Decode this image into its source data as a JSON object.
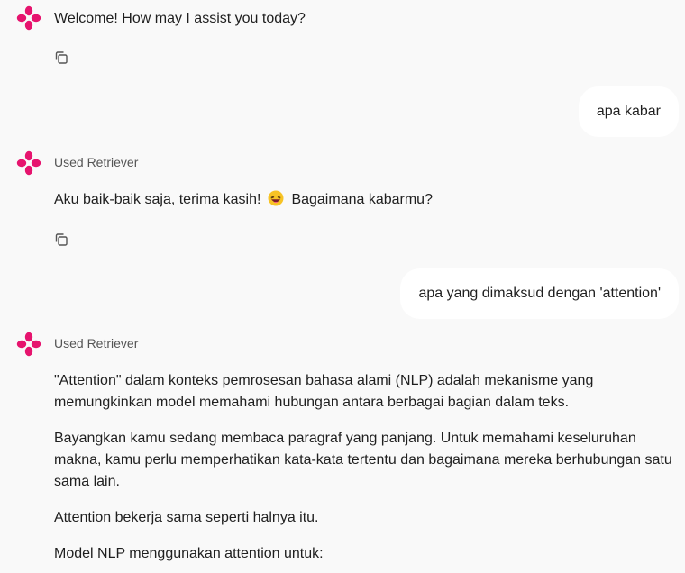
{
  "messages": {
    "bot1": {
      "text": "Welcome! How may I assist you today?"
    },
    "user1": {
      "text": "apa kabar"
    },
    "bot2": {
      "tool": "Used Retriever",
      "text_before": "Aku baik-baik saja, terima kasih!",
      "emoji": "grinning-squinting-face",
      "text_after": "Bagaimana kabarmu?"
    },
    "user2": {
      "text": "apa yang dimaksud dengan 'attention'"
    },
    "bot3": {
      "tool": "Used Retriever",
      "paragraphs": [
        "\"Attention\" dalam konteks pemrosesan bahasa alami (NLP) adalah mekanisme yang memungkinkan model memahami hubungan antara berbagai bagian dalam teks.",
        "Bayangkan kamu sedang membaca paragraf yang panjang.  Untuk memahami keseluruhan makna, kamu perlu memperhatikan kata-kata tertentu dan bagaimana mereka berhubungan satu sama lain.",
        "Attention bekerja sama seperti halnya itu.",
        "Model NLP menggunakan attention untuk:"
      ]
    }
  },
  "colors": {
    "avatar": "#e6146e",
    "background": "#f9f9f9",
    "user_bubble": "#ffffff"
  },
  "icons": {
    "avatar": "flower-logo-icon",
    "copy": "copy-icon"
  }
}
